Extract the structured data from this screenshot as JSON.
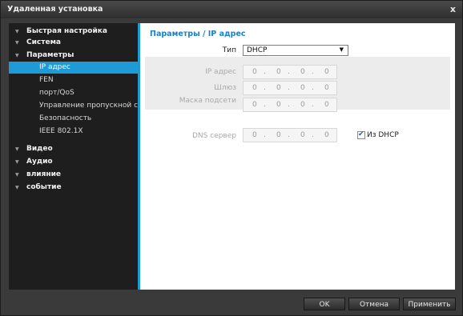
{
  "window": {
    "title": "Удаленная установка",
    "close_label": "x"
  },
  "sidebar": {
    "items": [
      {
        "label": "Быстрая настройка",
        "level": "top"
      },
      {
        "label": "Система",
        "level": "top"
      },
      {
        "label": "Параметры",
        "level": "top"
      },
      {
        "label": "IP адрес",
        "level": "sub",
        "selected": true
      },
      {
        "label": "FEN",
        "level": "sub"
      },
      {
        "label": "порт/QoS",
        "level": "sub"
      },
      {
        "label": "Управление пропускной спо",
        "level": "sub"
      },
      {
        "label": "Безопасность",
        "level": "sub"
      },
      {
        "label": "IEEE 802.1X",
        "level": "sub"
      },
      {
        "label": "Видео",
        "level": "top"
      },
      {
        "label": "Аудио",
        "level": "top"
      },
      {
        "label": "влияние",
        "level": "top"
      },
      {
        "label": "событие",
        "level": "top"
      }
    ]
  },
  "content": {
    "heading": "Параметры / IP адрес",
    "type": {
      "label": "Тип",
      "value": "DHCP"
    },
    "ip_address": {
      "label": "IP адрес",
      "octets": [
        "0",
        "0",
        "0",
        "0"
      ]
    },
    "gateway": {
      "label": "Шлюз",
      "octets": [
        "0",
        "0",
        "0",
        "0"
      ]
    },
    "subnet_mask": {
      "label": "Маска подсети",
      "octets": [
        "0",
        "0",
        "0",
        "0"
      ]
    },
    "dns_server": {
      "label": "DNS сервер",
      "octets": [
        "0",
        "0",
        "0",
        "0"
      ]
    },
    "from_dhcp": {
      "label": "Из DHCP",
      "checked": true
    },
    "separator": "."
  },
  "buttons": {
    "ok": "OK",
    "cancel": "Отмена",
    "apply": "Применить"
  },
  "colors": {
    "accent": "#1e9ad6",
    "heading": "#1b7fc2",
    "sidebar_bg": "#1e1e1e",
    "frame_bg": "#3a3a3a"
  }
}
